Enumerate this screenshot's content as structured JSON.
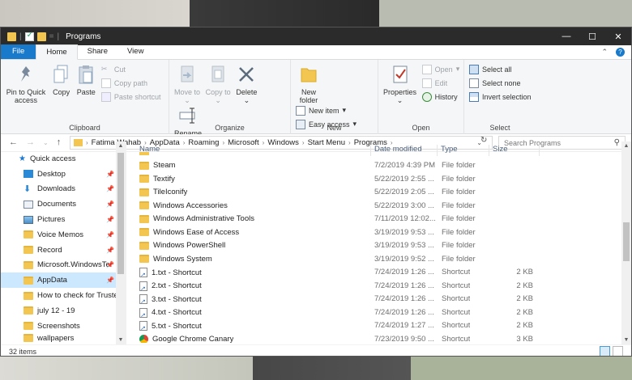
{
  "window": {
    "title": "Programs"
  },
  "titlebar_controls": {
    "minimize": "—",
    "maximize": "☐",
    "close": "✕"
  },
  "ribbon_tabs": [
    {
      "label": "File"
    },
    {
      "label": "Home"
    },
    {
      "label": "Share"
    },
    {
      "label": "View"
    }
  ],
  "ribbon": {
    "clipboard": {
      "label": "Clipboard",
      "pin": "Pin to Quick access",
      "copy": "Copy",
      "paste": "Paste",
      "cut": "Cut",
      "copy_path": "Copy path",
      "paste_shortcut": "Paste shortcut"
    },
    "organize": {
      "label": "Organize",
      "move_to": "Move to",
      "copy_to": "Copy to",
      "delete": "Delete",
      "rename": "Rename"
    },
    "new": {
      "label": "New",
      "new_folder": "New folder",
      "new_item": "New item",
      "easy_access": "Easy access"
    },
    "open": {
      "label": "Open",
      "properties": "Properties",
      "open": "Open",
      "edit": "Edit",
      "history": "History"
    },
    "select": {
      "label": "Select",
      "select_all": "Select all",
      "select_none": "Select none",
      "invert": "Invert selection"
    }
  },
  "address": {
    "breadcrumbs": [
      "Fatima Wahab",
      "AppData",
      "Roaming",
      "Microsoft",
      "Windows",
      "Start Menu",
      "Programs"
    ],
    "search_placeholder": "Search Programs"
  },
  "nav_pane": {
    "items": [
      {
        "label": "Quick access",
        "icon": "star-icon"
      },
      {
        "label": "Desktop",
        "icon": "desktop-icon"
      },
      {
        "label": "Downloads",
        "icon": "download-icon"
      },
      {
        "label": "Documents",
        "icon": "documents-icon"
      },
      {
        "label": "Pictures",
        "icon": "pictures-icon"
      },
      {
        "label": "Voice Memos",
        "icon": "folder-icon"
      },
      {
        "label": "Record",
        "icon": "folder-icon"
      },
      {
        "label": "Microsoft.WindowsTe",
        "icon": "folder-icon"
      },
      {
        "label": "AppData",
        "icon": "folder-icon"
      },
      {
        "label": "How to check for Truste",
        "icon": "folder-icon"
      },
      {
        "label": "july 12 - 19",
        "icon": "folder-icon"
      },
      {
        "label": "Screenshots",
        "icon": "folder-icon"
      },
      {
        "label": "wallpapers",
        "icon": "folder-icon"
      }
    ]
  },
  "columns": {
    "name": "Name",
    "date": "Date modified",
    "type": "Type",
    "size": "Size"
  },
  "files": [
    {
      "name": "Steam",
      "date": "7/2/2019 4:39 PM",
      "type": "File folder",
      "size": "",
      "icon": "folder"
    },
    {
      "name": "Textify",
      "date": "5/22/2019 2:55 ...",
      "type": "File folder",
      "size": "",
      "icon": "folder"
    },
    {
      "name": "TileIconify",
      "date": "5/22/2019 2:05 ...",
      "type": "File folder",
      "size": "",
      "icon": "folder"
    },
    {
      "name": "Windows Accessories",
      "date": "5/22/2019 3:00 ...",
      "type": "File folder",
      "size": "",
      "icon": "folder"
    },
    {
      "name": "Windows Administrative Tools",
      "date": "7/11/2019 12:02...",
      "type": "File folder",
      "size": "",
      "icon": "folder"
    },
    {
      "name": "Windows Ease of Access",
      "date": "3/19/2019 9:53 ...",
      "type": "File folder",
      "size": "",
      "icon": "folder"
    },
    {
      "name": "Windows PowerShell",
      "date": "3/19/2019 9:53 ...",
      "type": "File folder",
      "size": "",
      "icon": "folder"
    },
    {
      "name": "Windows System",
      "date": "3/19/2019 9:52 ...",
      "type": "File folder",
      "size": "",
      "icon": "folder"
    },
    {
      "name": "1.txt - Shortcut",
      "date": "7/24/2019 1:26 ...",
      "type": "Shortcut",
      "size": "2 KB",
      "icon": "shortcut"
    },
    {
      "name": "2.txt - Shortcut",
      "date": "7/24/2019 1:26 ...",
      "type": "Shortcut",
      "size": "2 KB",
      "icon": "shortcut"
    },
    {
      "name": "3.txt - Shortcut",
      "date": "7/24/2019 1:26 ...",
      "type": "Shortcut",
      "size": "2 KB",
      "icon": "shortcut"
    },
    {
      "name": "4.txt - Shortcut",
      "date": "7/24/2019 1:26 ...",
      "type": "Shortcut",
      "size": "2 KB",
      "icon": "shortcut"
    },
    {
      "name": "5.txt - Shortcut",
      "date": "7/24/2019 1:27 ...",
      "type": "Shortcut",
      "size": "2 KB",
      "icon": "shortcut"
    },
    {
      "name": "Google Chrome Canary",
      "date": "7/23/2019 9:50 ...",
      "type": "Shortcut",
      "size": "3 KB",
      "icon": "chrome"
    }
  ],
  "status": {
    "item_count": "32 items"
  }
}
